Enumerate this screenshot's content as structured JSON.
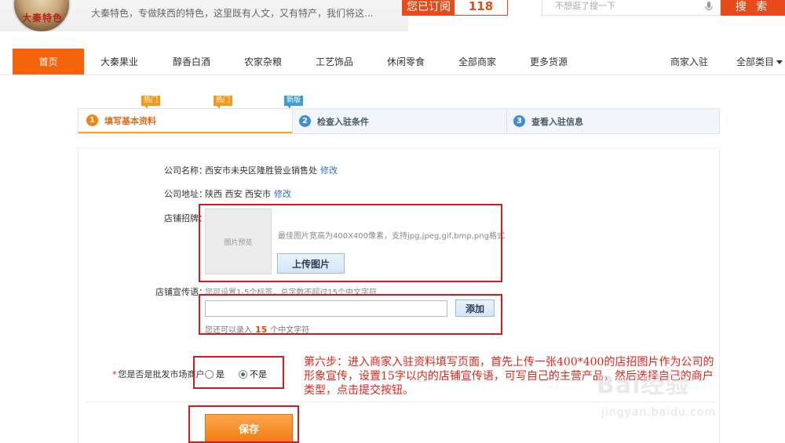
{
  "header": {
    "logo_text": "大秦特色",
    "slogan": "大秦特色，专做陕西的特色，这里既有人文，又有特产，我们将这...",
    "subscribe_label": "您已订阅",
    "subscribe_count": "118",
    "search_placeholder": "不想逛了搜一下",
    "search_button": "搜 索"
  },
  "nav": {
    "home": "首页",
    "items": [
      {
        "label": "大秦果业",
        "badge": "热门"
      },
      {
        "label": "醇香白酒",
        "badge": "热门"
      },
      {
        "label": "农家杂粮",
        "badge": "新版"
      },
      {
        "label": "工艺饰品",
        "badge": ""
      },
      {
        "label": "休闲零食",
        "badge": ""
      },
      {
        "label": "全部商家",
        "badge": ""
      },
      {
        "label": "更多货源",
        "badge": ""
      }
    ],
    "merchant_join": "商家入驻",
    "all_categories": "全部类目"
  },
  "steps": [
    {
      "num": "1",
      "label": "填写基本资料",
      "active": true
    },
    {
      "num": "2",
      "label": "检查入驻条件",
      "active": false
    },
    {
      "num": "3",
      "label": "查看入驻信息",
      "active": false
    }
  ],
  "form": {
    "company_name_label": "公司名称：",
    "company_name_value": "西安市未央区隆胜管业销售处",
    "company_name_edit": "修改",
    "company_address_label": "公司地址：",
    "company_address_value": "陕西 西安 西安市",
    "company_address_edit": "修改",
    "shop_sign_label": "店铺招牌：",
    "image_preview": "图片预览",
    "image_hint": "最佳图片宽高为400X400像素，支持jpg,jpeg,gif,bmp,png格式",
    "upload_button": "上传图片",
    "shop_slogan_label": "店铺宣传语：",
    "shop_slogan_hint": "您可设置1-5个标签，总字数不超过15个中文字符",
    "slogan_value": "",
    "add_button": "添加",
    "remain_prefix": "您还可以录入",
    "remain_count": "15",
    "remain_suffix": "个中文字符",
    "wholesale_label": "您是否是批发市场商户：",
    "required_mark": "*",
    "option_yes": "是",
    "option_no": "不是",
    "selected_option": "不是",
    "save_button": "保存"
  },
  "annotation": "第六步：进入商家入驻资料填写页面，首先上传一张400*400的店招图片作为公司的形象宣传，设置15字以内的店铺宣传语，可写自己的主营产品，然后选择自己的商户类型，点击提交按钮。",
  "watermark": {
    "brand": "Bai经验",
    "url": "jingyan.baidu.com"
  },
  "colors": {
    "accent_orange": "#f5640a",
    "annotation_red": "#e0251b",
    "link_blue": "#2b6cc4"
  }
}
